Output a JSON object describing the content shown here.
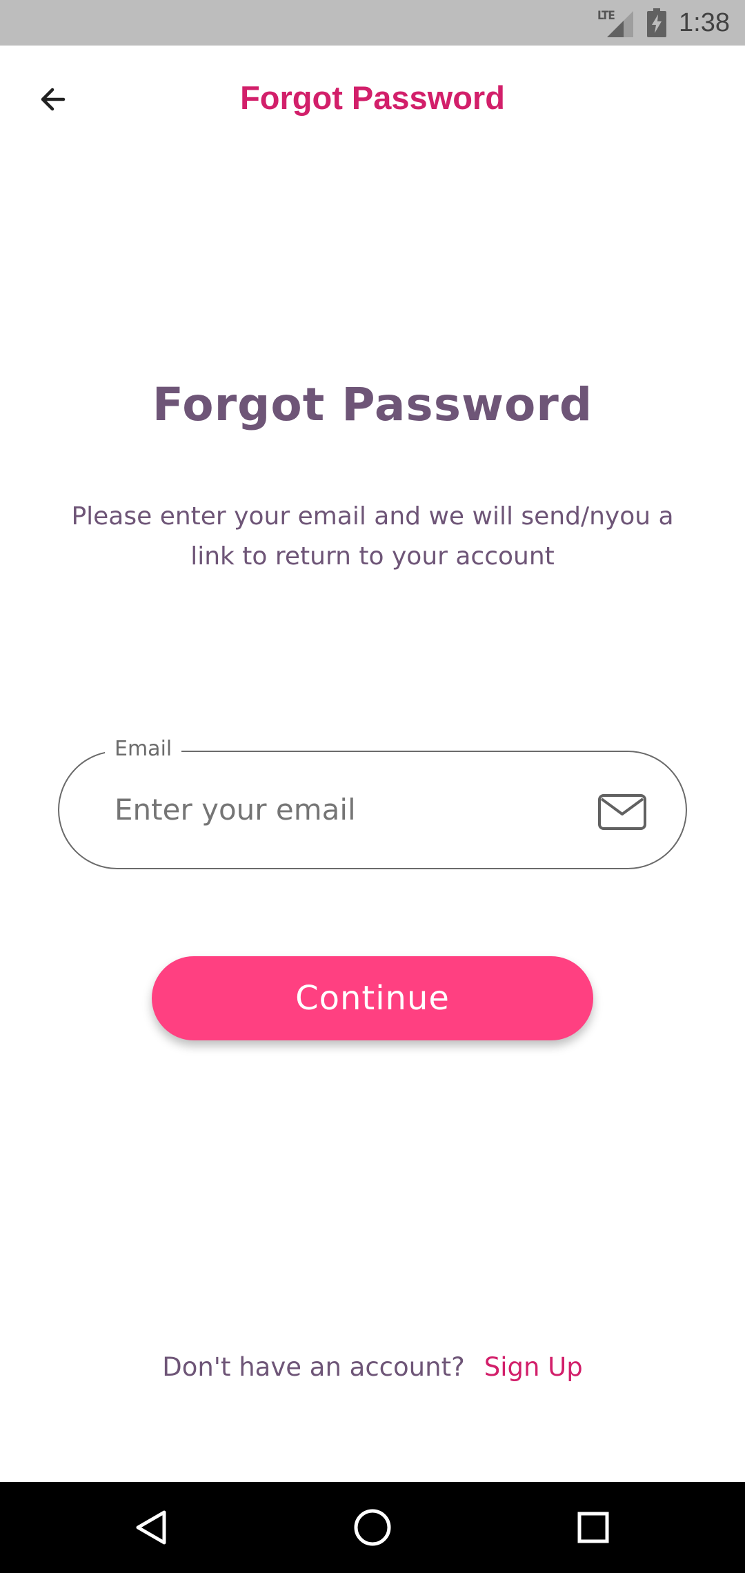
{
  "status_bar": {
    "network_label": "LTE",
    "time": "1:38"
  },
  "app_bar": {
    "title": "Forgot Password",
    "back_icon": "arrow-left-icon"
  },
  "main": {
    "title": "Forgot Password",
    "subtitle": "Please enter your email and we will send/nyou a link to return to your account"
  },
  "email_field": {
    "label": "Email",
    "placeholder": "Enter your email",
    "value": "",
    "icon": "mail-icon"
  },
  "continue_button": {
    "label": "Continue"
  },
  "footer": {
    "prompt": "Don't have an account?",
    "link_label": "Sign Up"
  },
  "navigation_bar": {
    "back_icon": "triangle-back-icon",
    "home_icon": "circle-home-icon",
    "recents_icon": "square-recents-icon"
  },
  "colors": {
    "accent": "#ff4081",
    "title_pink": "#d21f6a",
    "text_purple": "#6e5577",
    "status_bar": "#bdbdbd",
    "nav_bar": "#000000"
  }
}
